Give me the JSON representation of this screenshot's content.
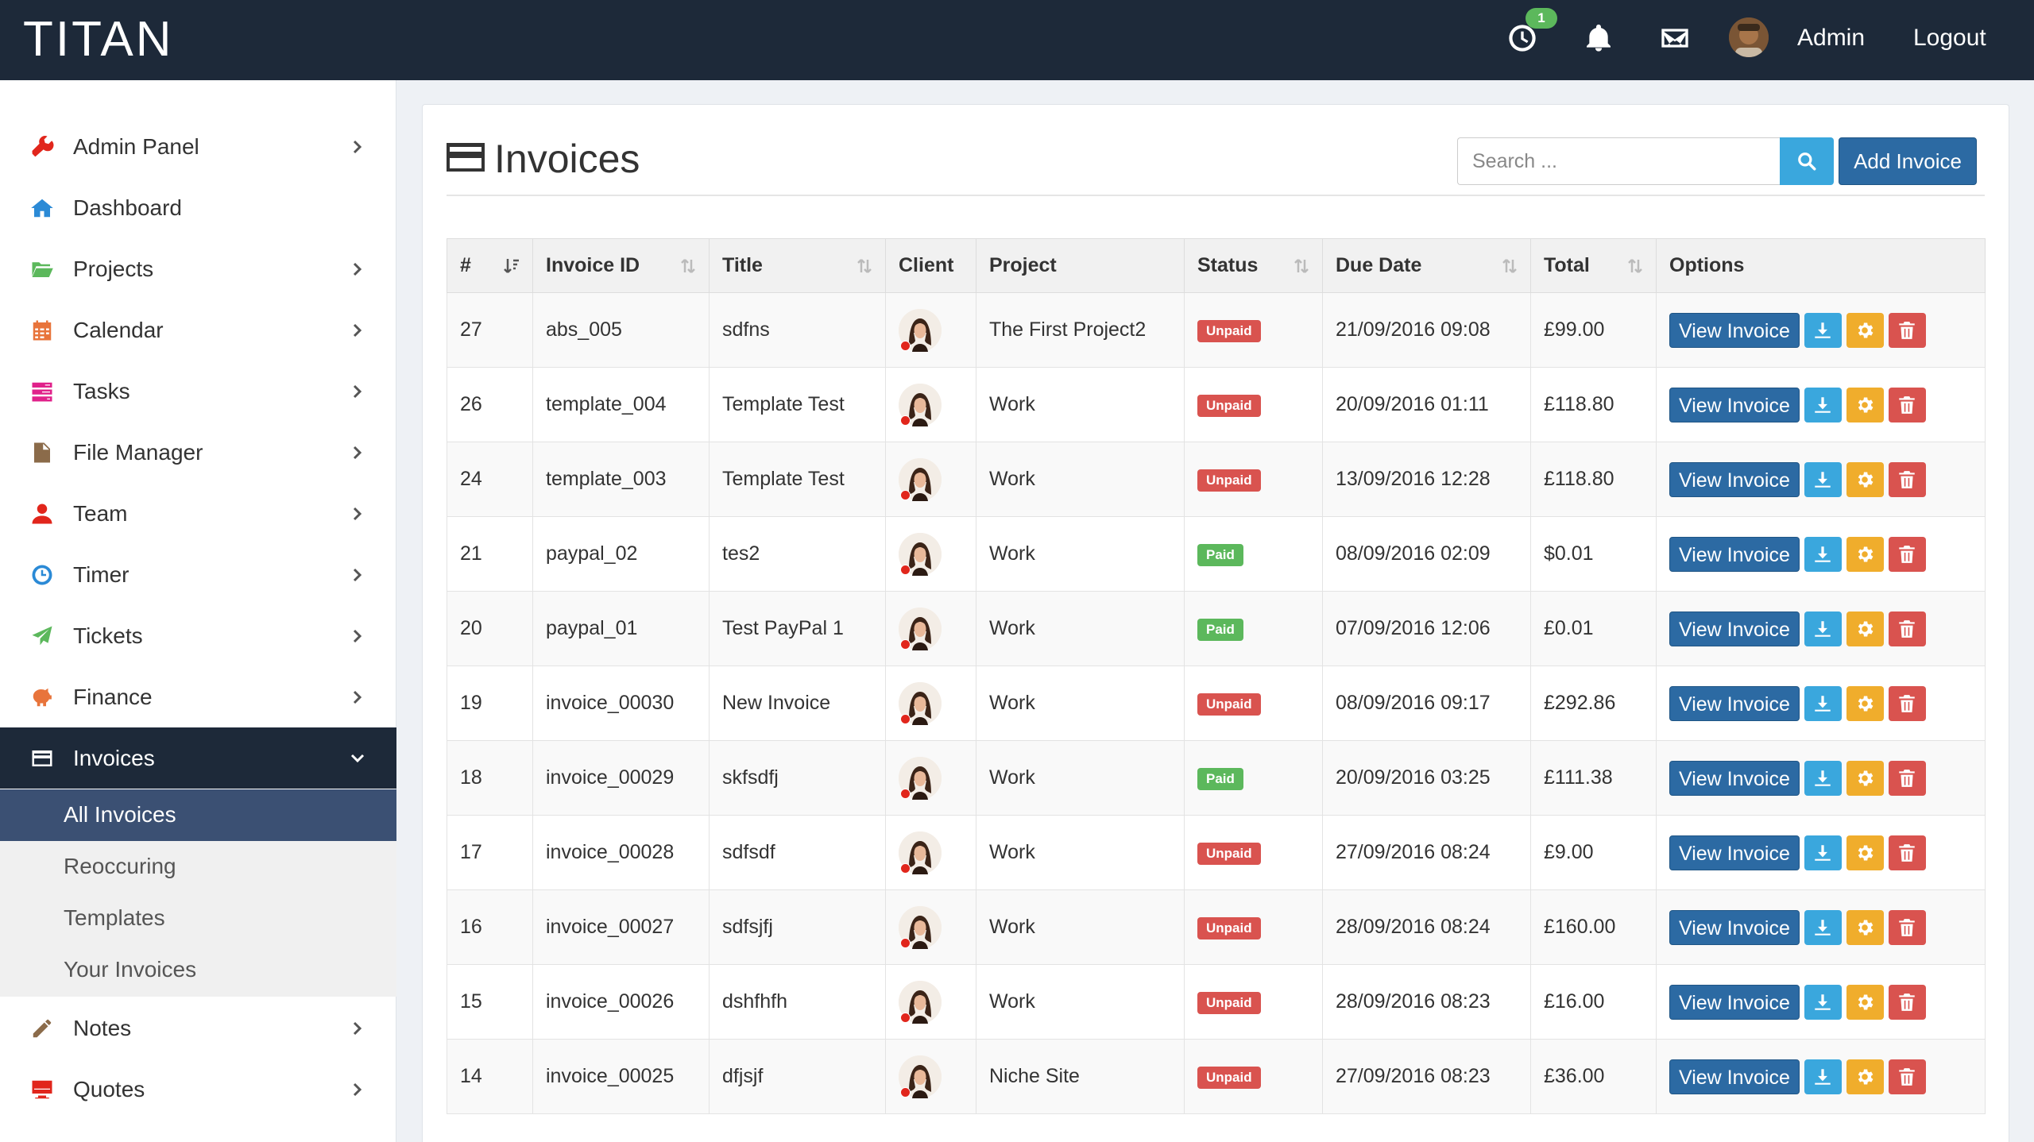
{
  "app": {
    "logo": "TITAN"
  },
  "topbar": {
    "timer_badge": "1",
    "user_name": "Admin",
    "logout_label": "Logout",
    "icons": [
      "clock-icon",
      "bell-icon",
      "envelope-icon"
    ]
  },
  "sidebar": {
    "items": [
      {
        "label": "Admin Panel",
        "icon": "wrench-icon",
        "color": "#e1261c",
        "has_children": true
      },
      {
        "label": "Dashboard",
        "icon": "home-icon",
        "color": "#2b8ad6",
        "has_children": false
      },
      {
        "label": "Projects",
        "icon": "folder-icon",
        "color": "#5cb85c",
        "has_children": true
      },
      {
        "label": "Calendar",
        "icon": "calendar-icon",
        "color": "#e8743b",
        "has_children": true
      },
      {
        "label": "Tasks",
        "icon": "tasks-icon",
        "color": "#e0218a",
        "has_children": true
      },
      {
        "label": "File Manager",
        "icon": "file-icon",
        "color": "#8b6b4a",
        "has_children": true
      },
      {
        "label": "Team",
        "icon": "user-icon",
        "color": "#e1261c",
        "has_children": true
      },
      {
        "label": "Timer",
        "icon": "clock-icon",
        "color": "#2b8ad6",
        "has_children": true
      },
      {
        "label": "Tickets",
        "icon": "paper-plane-icon",
        "color": "#5cb85c",
        "has_children": true
      },
      {
        "label": "Finance",
        "icon": "piggy-bank-icon",
        "color": "#e8743b",
        "has_children": true
      },
      {
        "label": "Invoices",
        "icon": "credit-card-icon",
        "color": "#ffffff",
        "has_children": true,
        "active": true
      },
      {
        "label": "Notes",
        "icon": "pencil-icon",
        "color": "#8b6b4a",
        "has_children": true
      },
      {
        "label": "Quotes",
        "icon": "monitor-icon",
        "color": "#e1261c",
        "has_children": true
      }
    ],
    "invoice_subitems": [
      "All Invoices",
      "Reoccuring",
      "Templates",
      "Your Invoices"
    ],
    "current_subitem": "All Invoices"
  },
  "page": {
    "title": "Invoices",
    "search_placeholder": "Search ...",
    "add_button": "Add Invoice"
  },
  "table": {
    "columns": [
      "#",
      "Invoice ID",
      "Title",
      "Client",
      "Project",
      "Status",
      "Due Date",
      "Total",
      "Options"
    ],
    "view_label": "View Invoice",
    "rows": [
      {
        "num": "27",
        "invoice_id": "abs_005",
        "title": "sdfns",
        "project": "The First Project2",
        "status": "Unpaid",
        "due": "21/09/2016 09:08",
        "total": "£99.00"
      },
      {
        "num": "26",
        "invoice_id": "template_004",
        "title": "Template Test",
        "project": "Work",
        "status": "Unpaid",
        "due": "20/09/2016 01:11",
        "total": "£118.80"
      },
      {
        "num": "24",
        "invoice_id": "template_003",
        "title": "Template Test",
        "project": "Work",
        "status": "Unpaid",
        "due": "13/09/2016 12:28",
        "total": "£118.80"
      },
      {
        "num": "21",
        "invoice_id": "paypal_02",
        "title": "tes2",
        "project": "Work",
        "status": "Paid",
        "due": "08/09/2016 02:09",
        "total": "$0.01"
      },
      {
        "num": "20",
        "invoice_id": "paypal_01",
        "title": "Test PayPal 1",
        "project": "Work",
        "status": "Paid",
        "due": "07/09/2016 12:06",
        "total": "£0.01"
      },
      {
        "num": "19",
        "invoice_id": "invoice_00030",
        "title": "New Invoice",
        "project": "Work",
        "status": "Unpaid",
        "due": "08/09/2016 09:17",
        "total": "£292.86"
      },
      {
        "num": "18",
        "invoice_id": "invoice_00029",
        "title": "skfsdfj",
        "project": "Work",
        "status": "Paid",
        "due": "20/09/2016 03:25",
        "total": "£111.38"
      },
      {
        "num": "17",
        "invoice_id": "invoice_00028",
        "title": "sdfsdf",
        "project": "Work",
        "status": "Unpaid",
        "due": "27/09/2016 08:24",
        "total": "£9.00"
      },
      {
        "num": "16",
        "invoice_id": "invoice_00027",
        "title": "sdfsjfj",
        "project": "Work",
        "status": "Unpaid",
        "due": "28/09/2016 08:24",
        "total": "£160.00"
      },
      {
        "num": "15",
        "invoice_id": "invoice_00026",
        "title": "dshfhfh",
        "project": "Work",
        "status": "Unpaid",
        "due": "28/09/2016 08:23",
        "total": "£16.00"
      },
      {
        "num": "14",
        "invoice_id": "invoice_00025",
        "title": "dfjsjf",
        "project": "Niche Site",
        "status": "Unpaid",
        "due": "27/09/2016 08:23",
        "total": "£36.00"
      }
    ]
  },
  "colors": {
    "topbar": "#1d2939",
    "primary": "#2c6aa3",
    "info": "#3aa7dd",
    "warning": "#f0ad2c",
    "danger": "#d9534f",
    "success": "#5cb85c"
  }
}
